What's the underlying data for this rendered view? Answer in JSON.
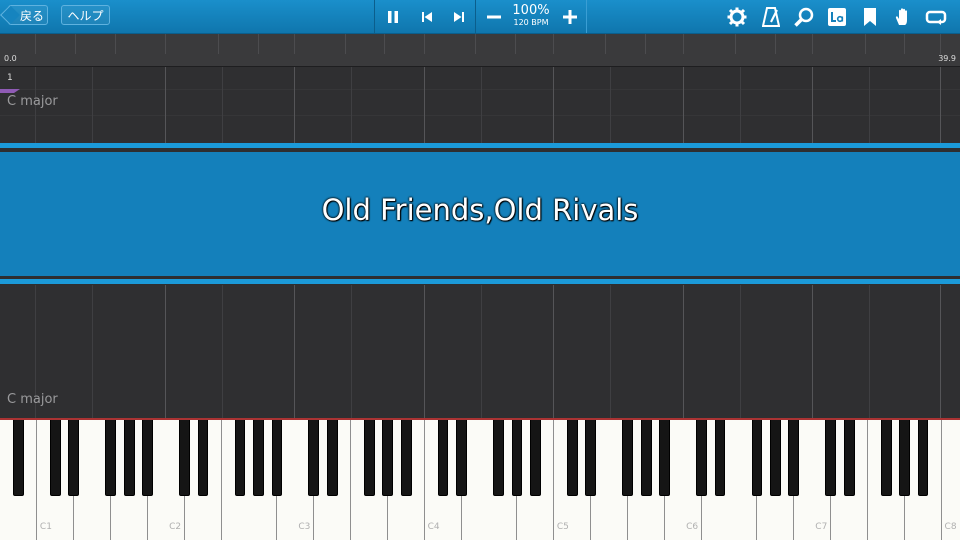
{
  "toolbar": {
    "back_label": "戻る",
    "help_label": "ヘルプ",
    "speed_percent": "100%",
    "tempo_label": "120 BPM"
  },
  "ruler": {
    "start": "0.0",
    "end": "39.9"
  },
  "track": {
    "measure_number": "1",
    "key_top": "C major",
    "key_bottom": "C major"
  },
  "title": "Old Friends,Old Rivals",
  "piano": {
    "octave_labels": [
      "C1",
      "C2",
      "C3",
      "C4",
      "C5",
      "C6",
      "C7",
      "C8"
    ]
  },
  "colors": {
    "toolbar": "#1480bb",
    "band": "#1480bb",
    "accent": "#1b9ad9",
    "marker": "#8f5bb5"
  },
  "icons": [
    "pause-icon",
    "skip-back-icon",
    "skip-forward-icon",
    "minus-icon",
    "plus-icon",
    "gear-icon",
    "metronome-icon",
    "magnifier-icon",
    "lyrics-icon",
    "bookmark-icon",
    "hand-icon",
    "loop-icon"
  ]
}
